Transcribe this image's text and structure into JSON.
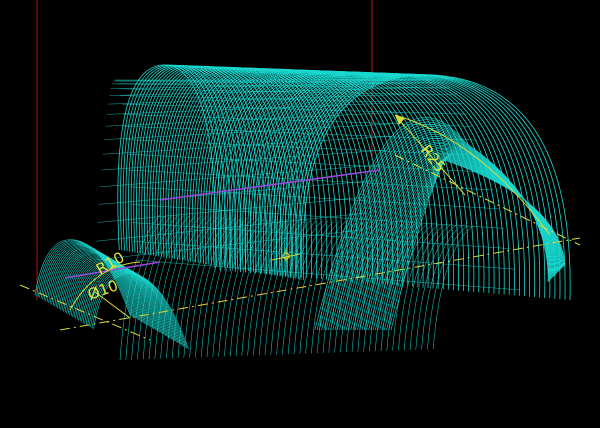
{
  "viewport": {
    "background": "#000000",
    "mesh_color": "#19d9d0",
    "dimension_color": "#d9d93a",
    "axis_color": "#b01818",
    "highlight_color": "#9a49d8"
  },
  "dimensions": {
    "large_radius": "R25",
    "small_radius": "R10",
    "small_diameter_label": "Ø10"
  },
  "icons": [
    "coordinate-axis-icon",
    "origin-marker-icon"
  ]
}
